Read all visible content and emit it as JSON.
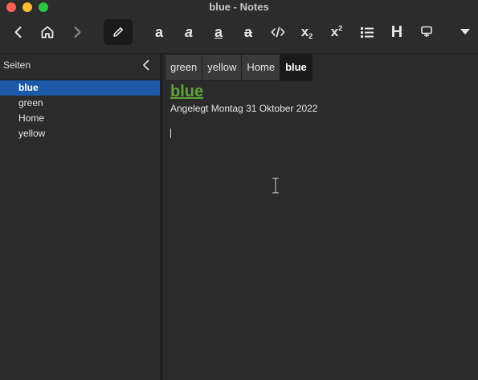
{
  "window": {
    "title": "blue - Notes"
  },
  "toolbar": {
    "icons": [
      "back-icon",
      "home-icon",
      "forward-icon",
      "edit-icon",
      "bold-icon",
      "italic-icon",
      "underline-icon",
      "strikethrough-icon",
      "code-icon",
      "subscript-icon",
      "superscript-icon",
      "bullet-list-icon",
      "heading-icon",
      "insert-icon",
      "dropdown-icon"
    ],
    "heading_glyph": "H"
  },
  "sidebar": {
    "title": "Seiten",
    "items": [
      {
        "label": "blue",
        "selected": true
      },
      {
        "label": "green"
      },
      {
        "label": "Home"
      },
      {
        "label": "yellow"
      }
    ]
  },
  "breadcrumb": [
    "green",
    "yellow",
    "Home",
    "blue"
  ],
  "page": {
    "title": "blue",
    "created": "Angelegt Montag 31 Oktober 2022"
  },
  "colors": {
    "accent": "#1c5aa8",
    "title_link": "#5fa33a"
  }
}
